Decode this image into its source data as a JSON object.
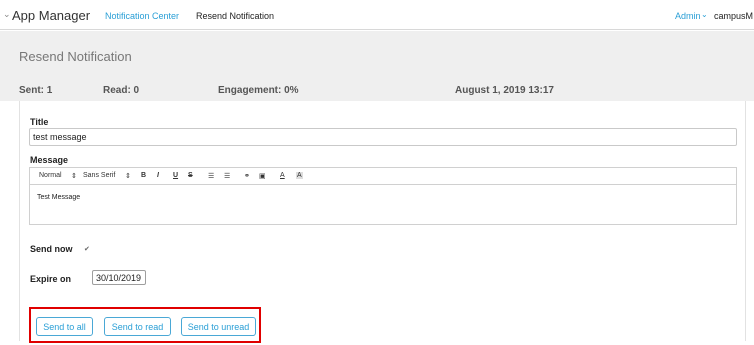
{
  "topbar": {
    "app_title": "App Manager",
    "breadcrumb": [
      "Notification Center",
      "Resend Notification"
    ],
    "admin_label": "Admin",
    "campus_label": "campusM"
  },
  "header": {
    "heading": "Resend Notification",
    "sent": "Sent: 1",
    "read": "Read: 0",
    "engagement": "Engagement: 0%",
    "date": "August 1, 2019 13:17"
  },
  "form": {
    "title_label": "Title",
    "title_value": "test message",
    "message_label": "Message",
    "toolbar": {
      "size": "Normal",
      "font": "Sans Serif",
      "bold": "B",
      "italic": "I",
      "underline": "U",
      "strike": "S"
    },
    "message_value": "Test Message",
    "send_now_label": "Send now",
    "send_now_checked": true,
    "expire_label": "Expire on",
    "expire_value": "30/10/2019"
  },
  "actions": {
    "send_all": "Send to all",
    "send_read": "Send to read",
    "send_unread": "Send to unread"
  },
  "colors": {
    "accent": "#2a9fd6",
    "highlight": "#e00000",
    "panel": "#efefef"
  }
}
